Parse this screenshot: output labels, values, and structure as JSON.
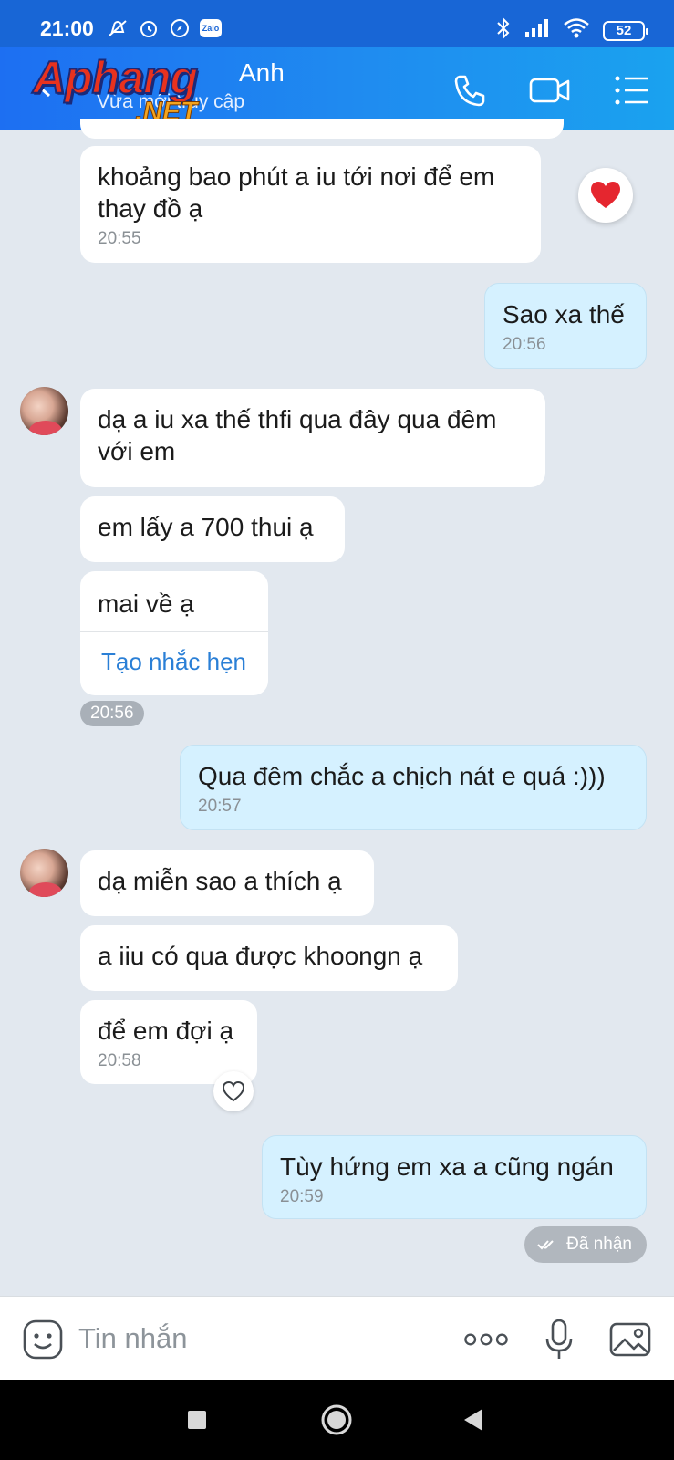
{
  "status_bar": {
    "time": "21:00",
    "zalo_badge": "Zalo",
    "battery": "52"
  },
  "header": {
    "contact_name": "Anh",
    "contact_status": "Vừa mới truy cập",
    "watermark_top": "Aphang",
    "watermark_bottom": ".NET"
  },
  "messages": [
    {
      "side": "in",
      "text": "khoảng bao phút a iu tới nơi để em thay đồ ạ",
      "time": "20:55",
      "reaction": "heart-red"
    },
    {
      "side": "out",
      "text": "Sao xa thế",
      "time": "20:56"
    },
    {
      "side": "in",
      "text": "dạ a iu xa thế thfi qua đây qua đêm với em"
    },
    {
      "side": "in",
      "text": "em lấy a 700 thui ạ"
    },
    {
      "side": "in",
      "text": "mai về ạ",
      "action": "Tạo nhắc hẹn",
      "time": "20:56"
    },
    {
      "side": "out",
      "text": "Qua đêm chắc a chịch nát e quá :)))",
      "time": "20:57"
    },
    {
      "side": "in",
      "text": "dạ miễn sao a thích ạ"
    },
    {
      "side": "in",
      "text": "a iiu có qua được khoongn ạ"
    },
    {
      "side": "in",
      "text": "để em đợi ạ",
      "time": "20:58"
    },
    {
      "side": "out",
      "text": "Tùy hứng em xa a cũng ngán",
      "time": "20:59"
    }
  ],
  "delivery_status": "Đã nhận",
  "input": {
    "placeholder": "Tin nhắn"
  },
  "colors": {
    "header": "#1f8cf0",
    "chat_bg": "#e2e8ef",
    "outgoing_bubble": "#d5f1ff",
    "incoming_bubble": "#ffffff",
    "link": "#2a7fd6"
  }
}
